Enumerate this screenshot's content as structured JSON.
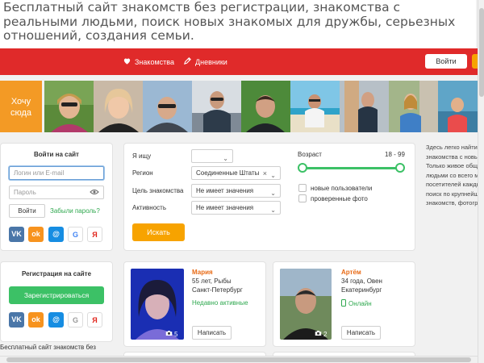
{
  "headline": "Бесплатный сайт знакомств без регистрации, знакомства с реальными людьми, поиск новых знакомых для дружбы, серьезных отношений, создания семьи.",
  "nav": {
    "items": [
      {
        "label": "Знакомства",
        "icon": "heart-icon"
      },
      {
        "label": "Дневники",
        "icon": "pencil-icon"
      }
    ],
    "login_label": "Войти"
  },
  "colors": {
    "brand_red": "#e02a2a",
    "accent_orange": "#f7a300",
    "accent_green": "#3cc166",
    "name_orange": "#e86b17"
  },
  "photo_strip": {
    "want_here": "Хочу сюда"
  },
  "login_box": {
    "title": "Войти на сайт",
    "login_placeholder": "Логин или E-mail",
    "password_placeholder": "Пароль",
    "submit_label": "Войти",
    "forgot_label": "Забыли пароль?",
    "socials": [
      {
        "name": "vk-icon",
        "glyph": "VK",
        "color": "#4a76a8"
      },
      {
        "name": "odnoklassniki-icon",
        "glyph": "ok",
        "color": "#f7931e"
      },
      {
        "name": "mailru-icon",
        "glyph": "@",
        "color": "#168de2"
      },
      {
        "name": "google-icon",
        "glyph": "G",
        "color": "#4285f4"
      },
      {
        "name": "yandex-icon",
        "glyph": "Я",
        "color": "#e0231a"
      }
    ]
  },
  "register_box": {
    "title": "Регистрация на сайте",
    "button_label": "Зарегистрироваться"
  },
  "search": {
    "looking_for_label": "Я ищу",
    "looking_for_value": "",
    "region_label": "Регион",
    "region_value": "Соединенные Штаты",
    "goal_label": "Цель знакомства",
    "goal_value": "Не имеет значения",
    "activity_label": "Активность",
    "activity_value": "Не имеет значения",
    "age_label": "Возраст",
    "age_range": "18 - 99",
    "age_min": 18,
    "age_max": 99,
    "new_users_label": "новые пользователи",
    "verified_photo_label": "проверенные фото",
    "submit_label": "Искать"
  },
  "side_text": [
    "Здесь легко найти",
    "знакомства с новыми",
    "Только живое общение",
    "людьми со всего мира",
    "посетителей каждый день",
    "поиск по крупнейшей",
    "знакомств, фотографиям"
  ],
  "profiles": [
    {
      "name": "Мария",
      "info1": "55 лет, Рыбы",
      "info2": "Санкт-Петербург",
      "status": "Недавно активные",
      "photos": "5",
      "write_label": "Написать",
      "online": false
    },
    {
      "name": "Артём",
      "info1": "34 года, Овен",
      "info2": "Екатеринбург",
      "status": "Онлайн",
      "photos": "2",
      "write_label": "Написать",
      "online": true
    }
  ],
  "bottom_text": "Бесплатный сайт знакомств без"
}
